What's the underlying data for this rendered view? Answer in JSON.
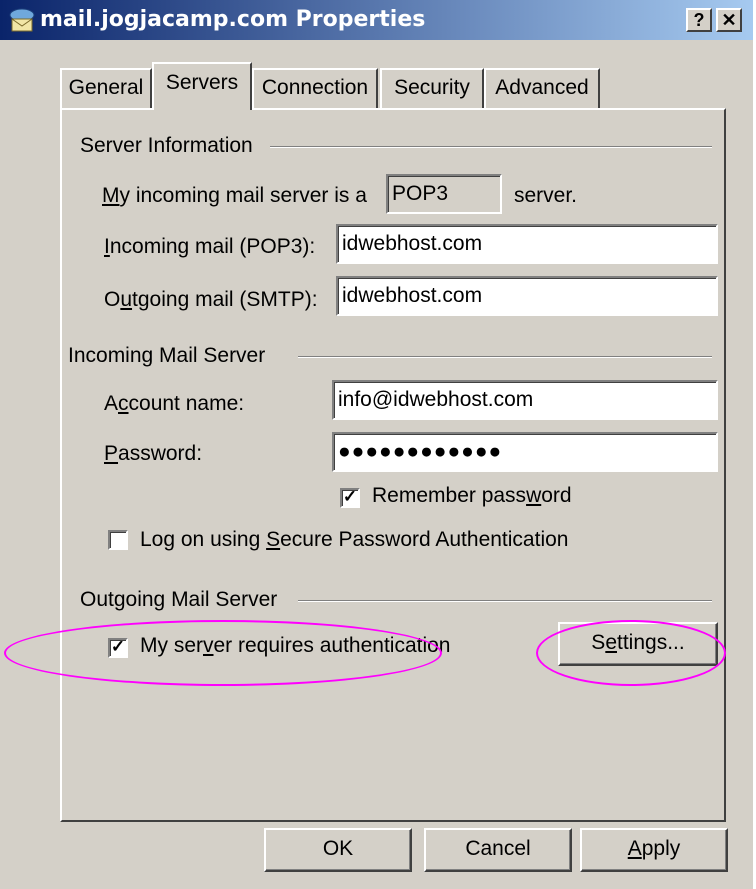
{
  "window": {
    "title": "mail.jogjacamp.com Properties",
    "help_button": "?",
    "close_button": "✕"
  },
  "tabs": [
    {
      "label": "General",
      "active": false
    },
    {
      "label": "Servers",
      "active": true
    },
    {
      "label": "Connection",
      "active": false
    },
    {
      "label": "Security",
      "active": false
    },
    {
      "label": "Advanced",
      "active": false
    }
  ],
  "server_information": {
    "group_label": "Server Information",
    "incoming_type": {
      "label_key": "M",
      "label_rest": "y incoming mail server is a",
      "value": "POP3",
      "suffix": "server."
    },
    "incoming_mail": {
      "label_key": "I",
      "label_rest": "ncoming mail (POP3):",
      "value": "idwebhost.com"
    },
    "outgoing_mail": {
      "label_pre": "O",
      "label_key": "u",
      "label_rest": "tgoing mail (SMTP):",
      "value": "idwebhost.com"
    }
  },
  "incoming_mail_server": {
    "group_label": "Incoming Mail Server",
    "account_name": {
      "label_pre": "A",
      "label_key": "c",
      "label_rest": "count name:",
      "value": "info@idwebhost.com"
    },
    "password": {
      "label_key": "P",
      "label_rest": "assword:",
      "value": "●●●●●●●●●●●●"
    },
    "remember_password": {
      "label_pre": "Remember pass",
      "label_key": "w",
      "label_rest": "ord",
      "checked": true
    },
    "spa": {
      "label_pre": "Log on using ",
      "label_key": "S",
      "label_rest": "ecure Password Authentication",
      "checked": false
    }
  },
  "outgoing_mail_server": {
    "group_label": "Outgoing Mail Server",
    "requires_auth": {
      "label_pre": "My ser",
      "label_key": "v",
      "label_rest": "er requires authentication",
      "checked": true
    },
    "settings_button": {
      "label_pre": "S",
      "label_key": "e",
      "label_rest": "ttings..."
    }
  },
  "footer": {
    "ok": "OK",
    "cancel": "Cancel",
    "apply_key": "A",
    "apply_rest": "pply"
  },
  "colors": {
    "highlight_ellipse": "#ff00ff",
    "title_gradient_start": "#0a246a",
    "title_gradient_end": "#a6caf0",
    "dialog_face": "#d4d0c8"
  }
}
